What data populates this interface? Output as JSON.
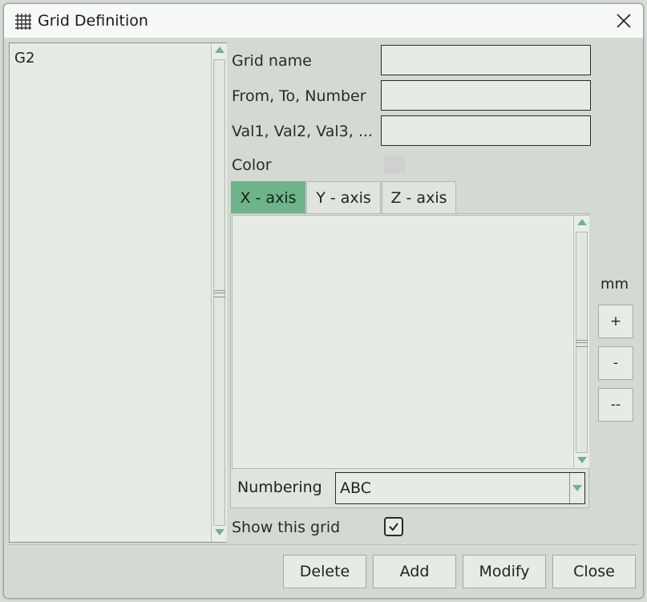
{
  "window": {
    "title": "Grid Definition"
  },
  "grid_list": {
    "items": [
      "G2"
    ]
  },
  "form": {
    "grid_name_label": "Grid name",
    "grid_name_value": "",
    "from_to_number_label": "From, To, Number",
    "from_to_number_value": "",
    "values_label": "Val1, Val2, Val3, ...",
    "values_value": "",
    "color_label": "Color",
    "color_value": "#cfd1cf"
  },
  "tabs": [
    {
      "label": "X - axis",
      "active": true
    },
    {
      "label": "Y - axis",
      "active": false
    },
    {
      "label": "Z - axis",
      "active": false
    }
  ],
  "axis_panel": {
    "numbering_label": "Numbering",
    "numbering_value": "ABC"
  },
  "side_controls": {
    "unit": "mm",
    "buttons": [
      "+",
      "-",
      "--"
    ]
  },
  "show_grid": {
    "label": "Show this grid",
    "checked": true
  },
  "footer": {
    "delete_label": "Delete",
    "add_label": "Add",
    "modify_label": "Modify",
    "close_label": "Close"
  },
  "colors": {
    "accent": "#6fb38b",
    "field_bg": "#e6ebe6",
    "window_bg": "#d4d9d4"
  }
}
